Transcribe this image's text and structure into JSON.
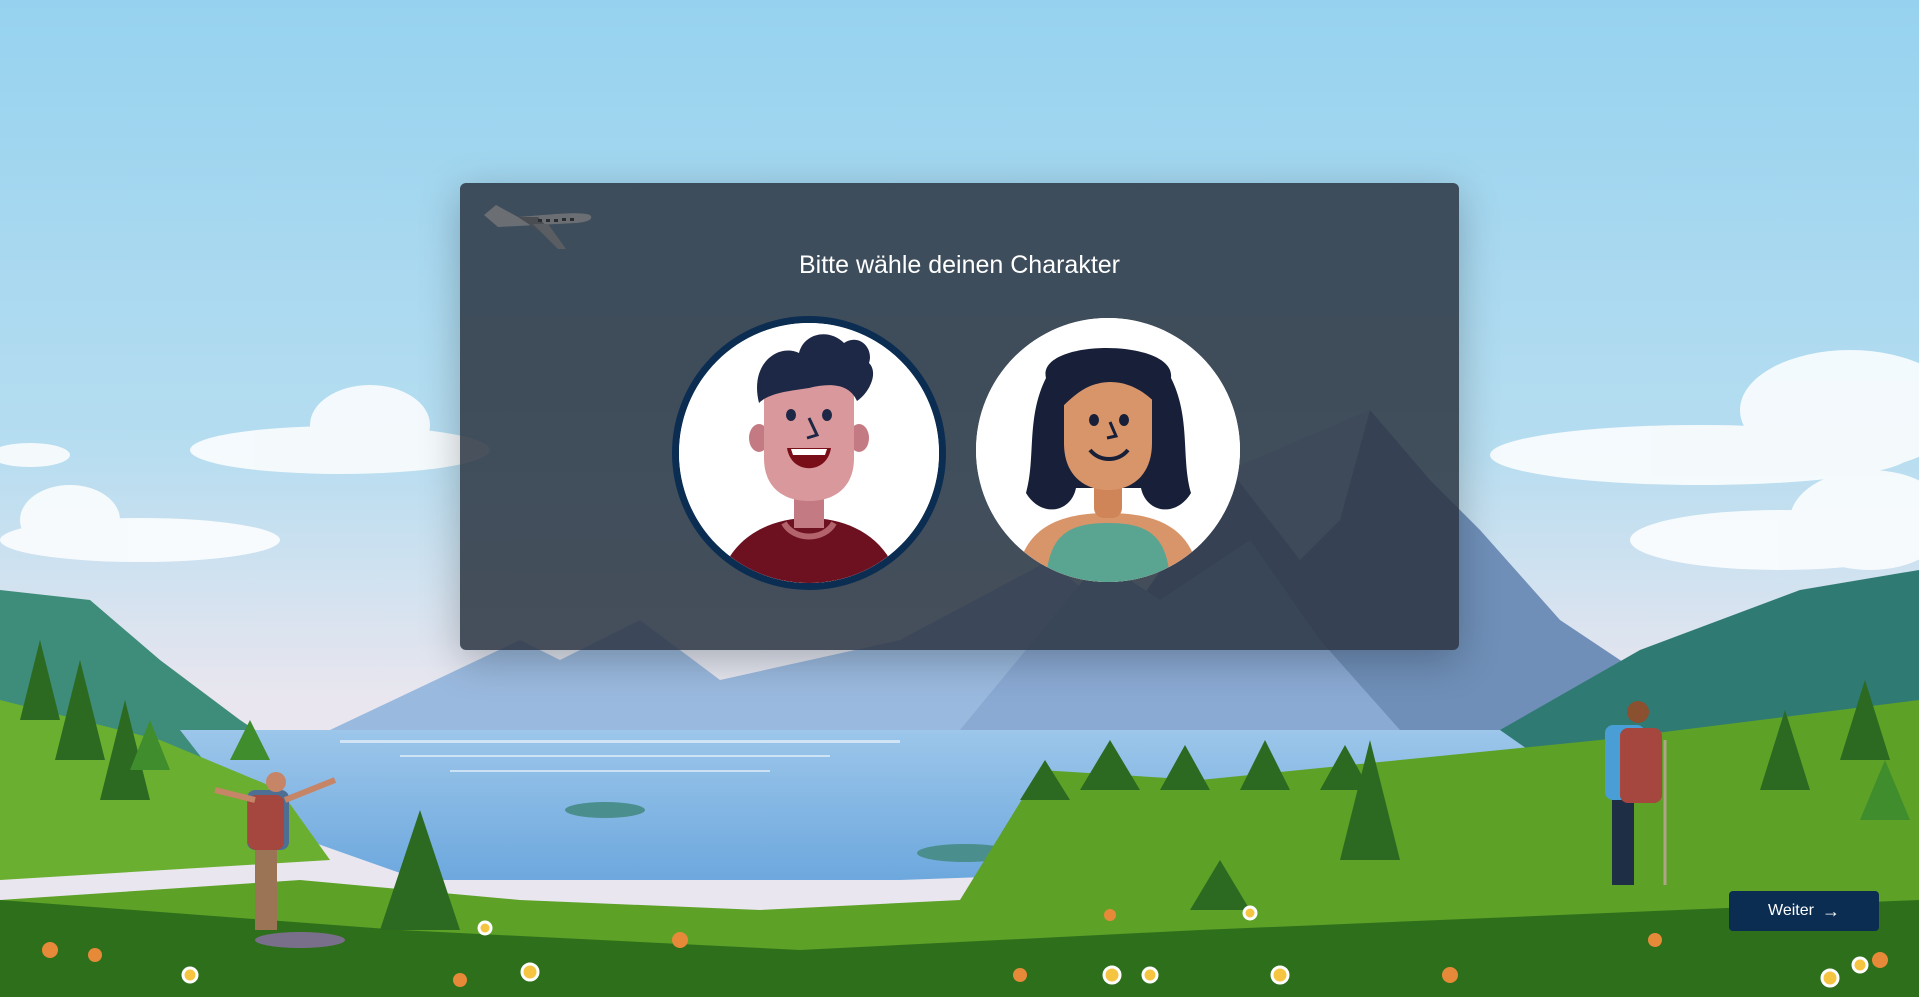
{
  "modal": {
    "title": "Bitte wähle deinen Charakter",
    "characters": [
      {
        "id": "male",
        "icon": "male-character-avatar",
        "selected": true
      },
      {
        "id": "female",
        "icon": "female-character-avatar",
        "selected": false
      }
    ]
  },
  "footer": {
    "next_label": "Weiter",
    "next_icon": "arrow-right-icon"
  },
  "colors": {
    "primary": "#0b2d52",
    "modal_background": "#2c3642"
  }
}
